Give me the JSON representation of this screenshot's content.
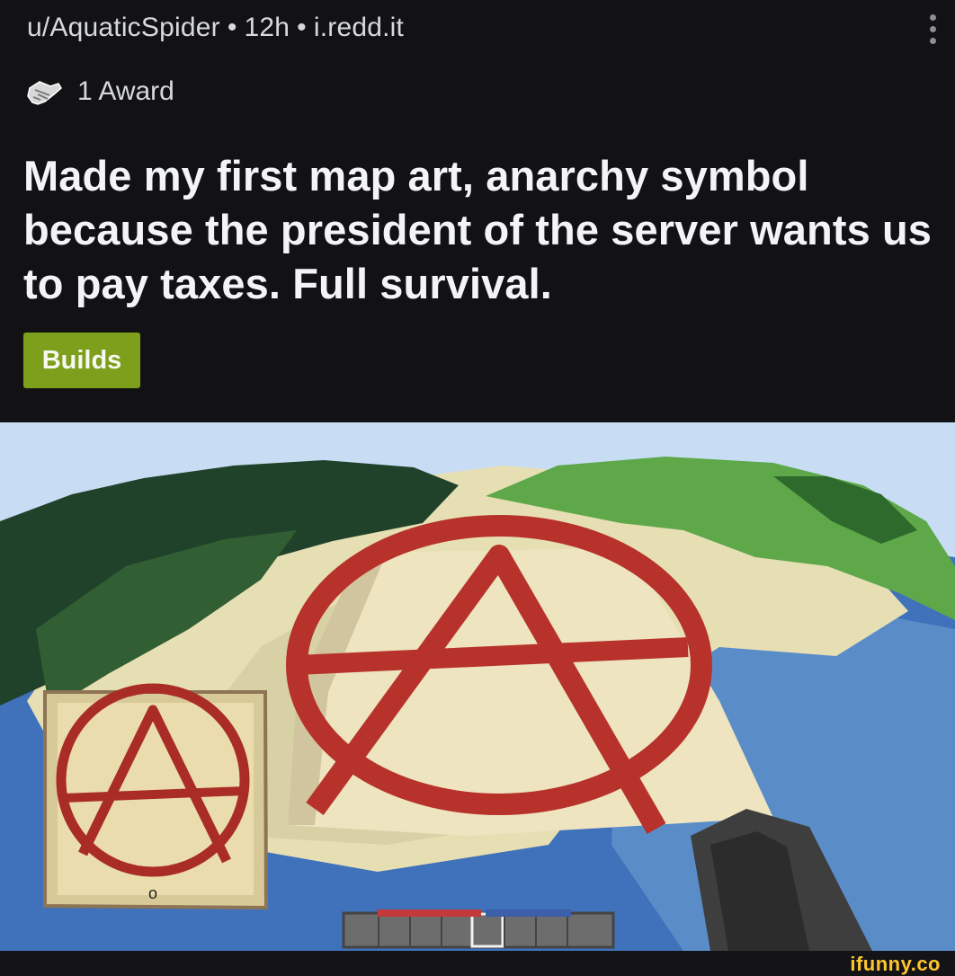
{
  "post": {
    "username": "u/AquaticSpider",
    "time": "12h",
    "domain": "i.redd.it",
    "separator": "•",
    "award_icon": "award-icon",
    "award_text": "1 Award",
    "title": "Made my first map art, anarchy symbol because the president of the server wants us to pay taxes. Full survival.",
    "flair": "Builds",
    "flair_color": "#7d9f1c",
    "menu_icon": "kebab-menu-icon"
  },
  "image": {
    "description_icon": "minecraft-screenshot",
    "map_marker": "o",
    "symbol_color": "#b7322b"
  },
  "watermark": {
    "text": "ifunny.co",
    "color": "#ffc52b"
  }
}
